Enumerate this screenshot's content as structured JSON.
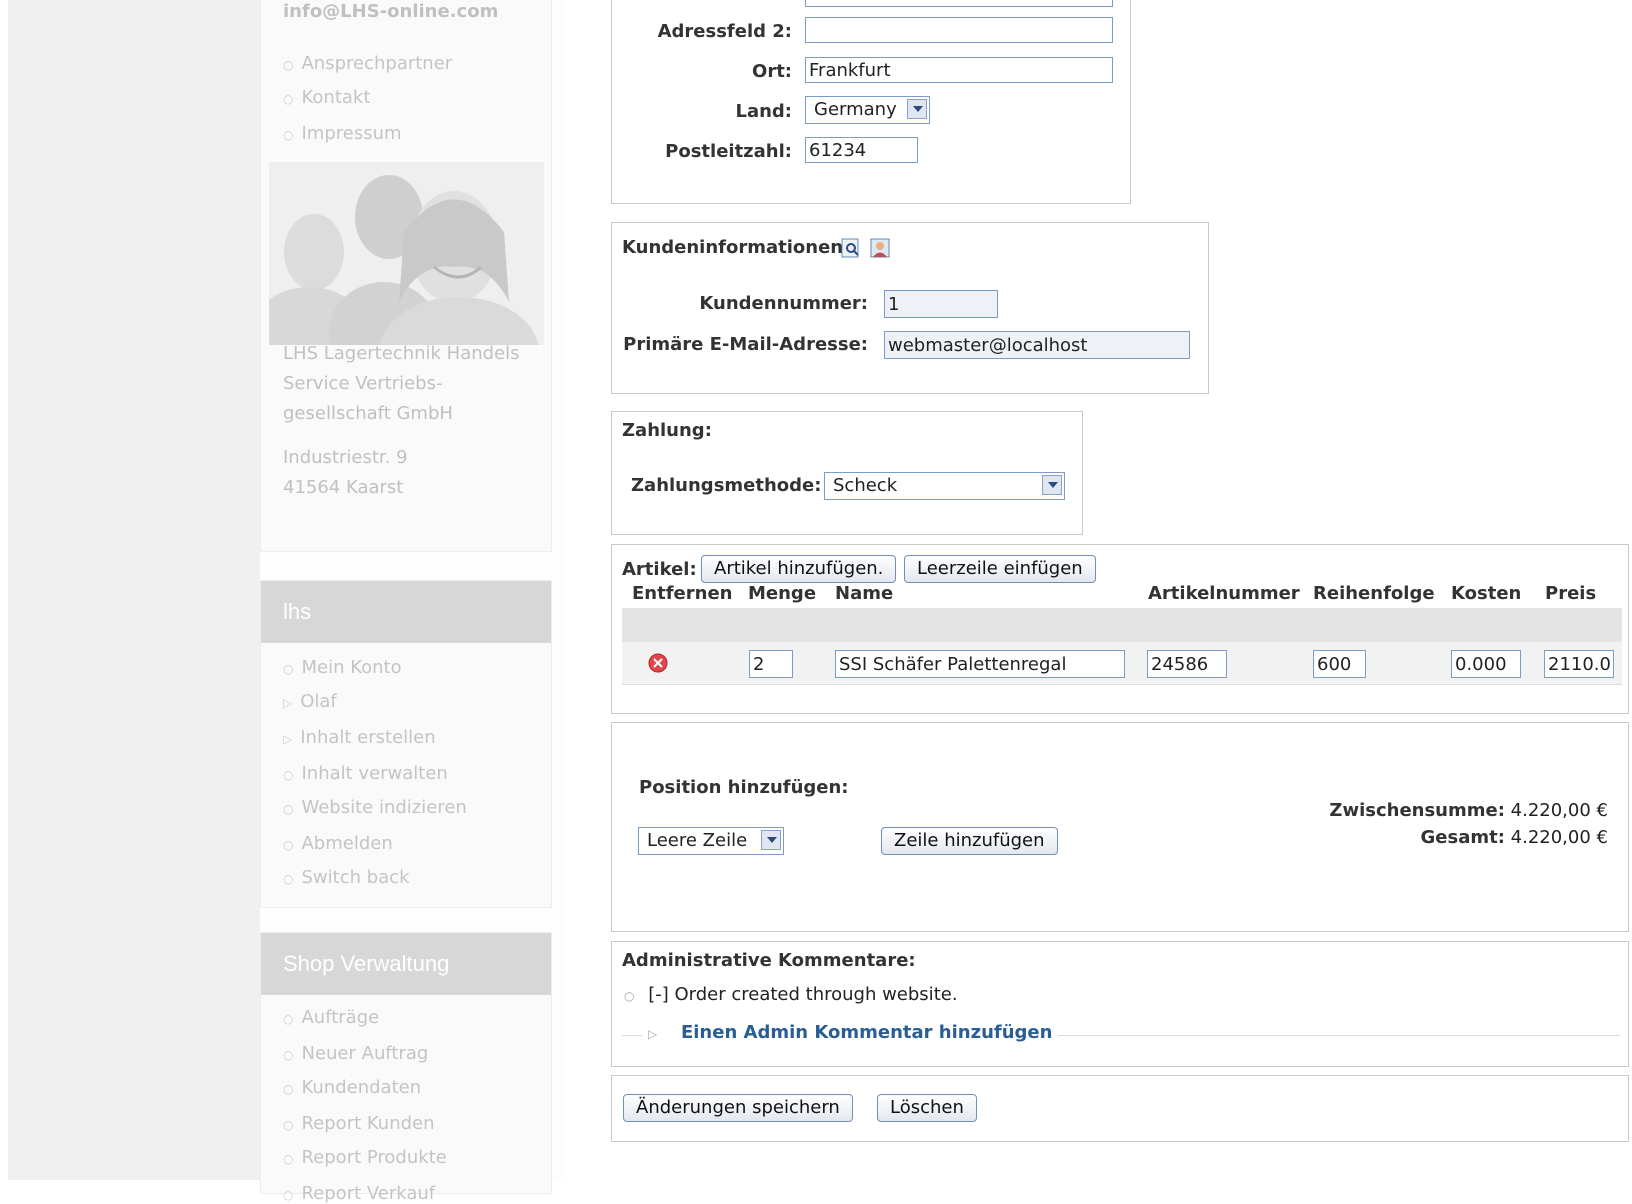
{
  "sidebar": {
    "email": "info@LHS-online.com",
    "top_links": [
      "Ansprechpartner",
      "Kontakt",
      "Impressum"
    ],
    "company": [
      "LHS Lagertechnik Handels",
      "Service Vertriebs-",
      "gesellschaft GmbH"
    ],
    "address": [
      "Industriestr. 9",
      "41564 Kaarst"
    ],
    "lhs_heading": "lhs",
    "lhs_links": [
      "Mein Konto",
      "Olaf",
      "Inhalt erstellen",
      "Inhalt verwalten",
      "Website indizieren",
      "Abmelden",
      "Switch back"
    ],
    "shop_heading": "Shop Verwaltung",
    "shop_links": [
      "Aufträge",
      "Neuer Auftrag",
      "Kundendaten",
      "Report Kunden",
      "Report Produkte",
      "Report Verkauf"
    ]
  },
  "address": {
    "addr2_label": "Adressfeld 2:",
    "addr2_value": "",
    "city_label": "Ort:",
    "city_value": "Frankfurt",
    "country_label": "Land:",
    "country_value": "Germany",
    "zip_label": "Postleitzahl:",
    "zip_value": "61234"
  },
  "customer": {
    "title": "Kundeninformationen:",
    "number_label": "Kundennummer:",
    "number_value": "1",
    "email_label": "Primäre E-Mail-Adresse:",
    "email_value": "webmaster@localhost"
  },
  "payment": {
    "title": "Zahlung:",
    "method_label": "Zahlungsmethode:",
    "method_value": "Scheck"
  },
  "articles": {
    "title": "Artikel:",
    "add_button": "Artikel hinzufügen.",
    "blank_button": "Leerzeile einfügen",
    "headers": [
      "Entfernen",
      "Menge",
      "Name",
      "Artikelnummer",
      "Reihenfolge",
      "Kosten",
      "Preis"
    ],
    "row": {
      "qty": "2",
      "name": "SSI Schäfer Palettenregal",
      "sku": "24586",
      "order": "600",
      "cost": "0.000",
      "price": "2110.0"
    }
  },
  "position": {
    "title": "Position hinzufügen:",
    "select_value": "Leere Zeile",
    "add_button": "Zeile hinzufügen",
    "subtotal_label": "Zwischensumme:",
    "subtotal_value": "4.220,00 €",
    "total_label": "Gesamt:",
    "total_value": "4.220,00 €"
  },
  "comments": {
    "title": "Administrative Kommentare:",
    "entry": "[-] Order created through website.",
    "add_link": "Einen Admin Kommentar hinzufügen"
  },
  "actions": {
    "save": "Änderungen speichern",
    "delete": "Löschen"
  },
  "colors": {
    "link_blue": "#2a5d96",
    "input_border": "#7a9cc7",
    "sidebar_heading_bg": "#d7d7d7"
  }
}
